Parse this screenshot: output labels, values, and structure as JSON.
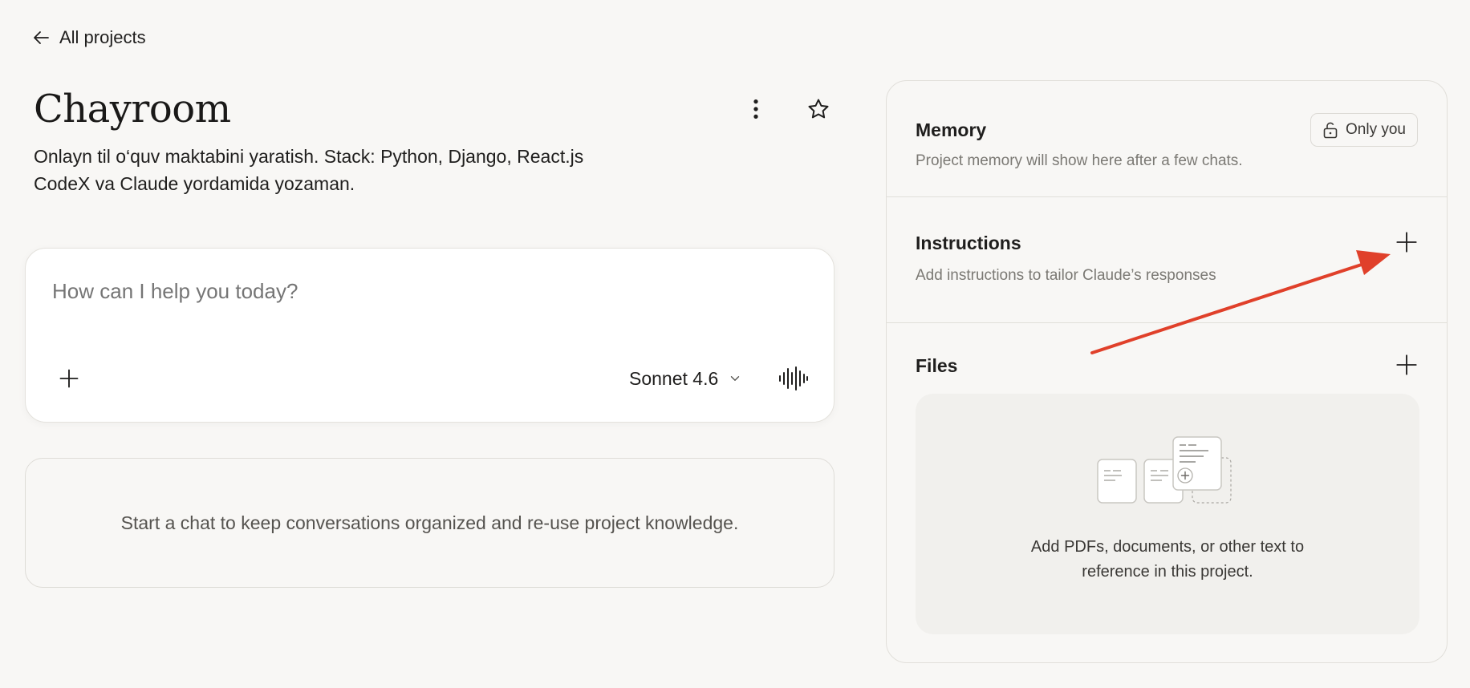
{
  "nav": {
    "back_label": "All projects"
  },
  "project": {
    "title": "Chayroom",
    "description_line1": "Onlayn til o‘quv maktabini yaratish. Stack: Python, Django, React.js",
    "description_line2": "CodeX va Claude yordamida yozaman."
  },
  "chat": {
    "placeholder": "How can I help you today?",
    "model": "Sonnet 4.6"
  },
  "empty_state": {
    "text": "Start a chat to keep conversations organized and re-use project knowledge."
  },
  "panel": {
    "memory": {
      "title": "Memory",
      "subtitle": "Project memory will show here after a few chats.",
      "visibility": "Only you"
    },
    "instructions": {
      "title": "Instructions",
      "subtitle": "Add instructions to tailor Claude’s responses"
    },
    "files": {
      "title": "Files",
      "empty_line1": "Add PDFs, documents, or other text to",
      "empty_line2": "reference in this project."
    }
  },
  "icons": {
    "back": "arrow-left-icon",
    "more": "more-vertical-icon",
    "star": "star-icon",
    "plus": "plus-icon",
    "chevron": "chevron-down-icon",
    "voice": "waveform-icon",
    "lock": "lock-icon"
  },
  "colors": {
    "background": "#f8f7f5",
    "card": "#ffffff",
    "annotation": "#e0402a"
  }
}
